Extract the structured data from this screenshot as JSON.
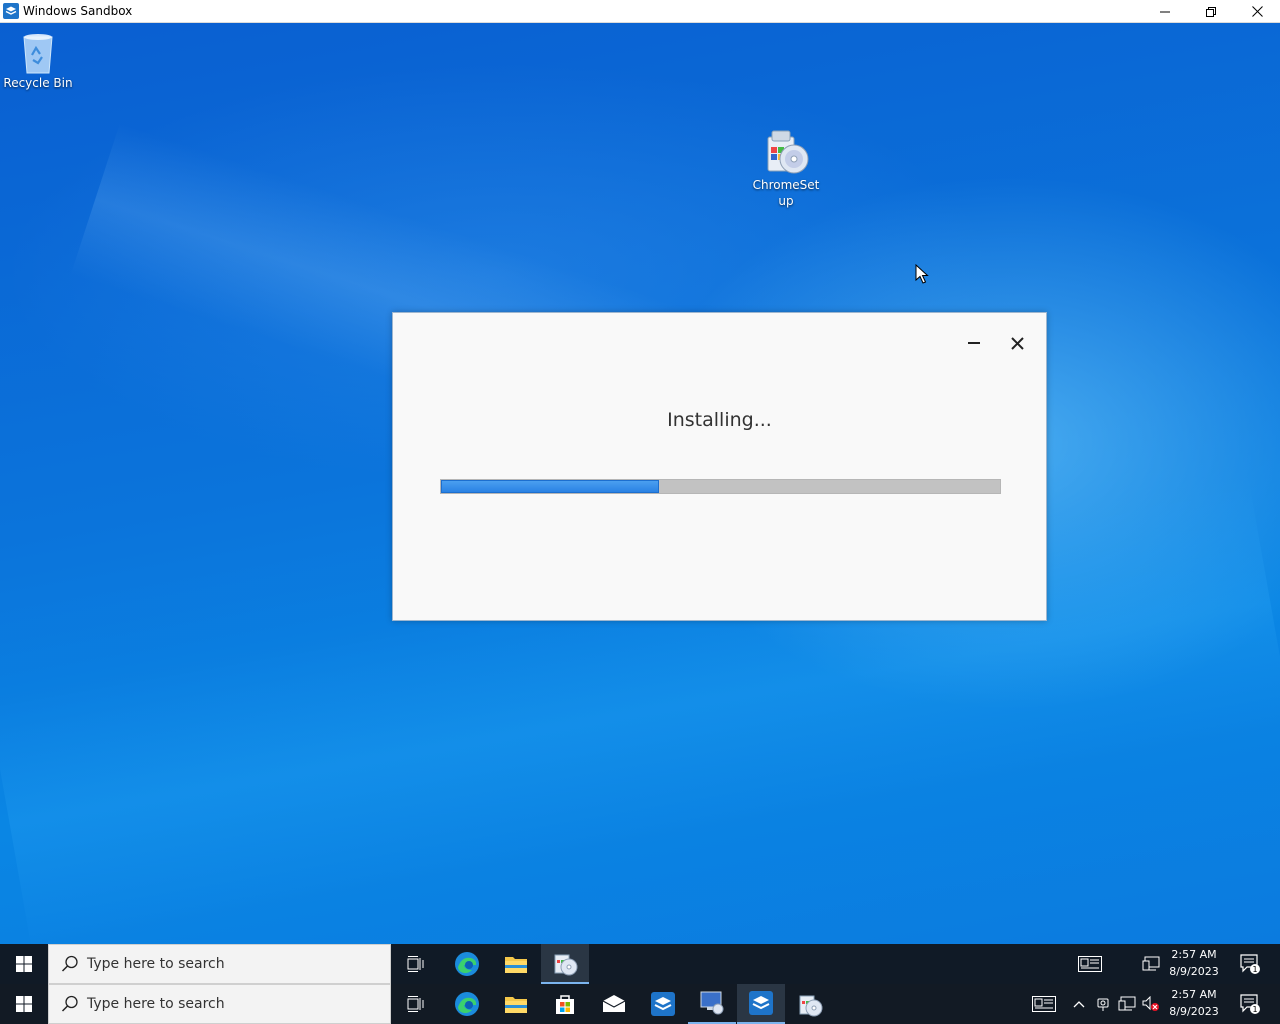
{
  "window": {
    "title": "Windows Sandbox",
    "icon": "windows-sandbox-icon",
    "controls": [
      "minimize-icon",
      "restore-icon",
      "close-icon"
    ]
  },
  "desktop": {
    "icons": [
      {
        "label": "Recycle Bin",
        "icon": "recycle-bin-icon"
      },
      {
        "label": "ChromeSetup",
        "icon": "installer-cd-icon"
      }
    ]
  },
  "installer": {
    "status": "Installing...",
    "progress": 0.39,
    "controls": [
      "minimize-icon",
      "close-icon"
    ],
    "colors": {
      "fill": "#2a82e4",
      "track": "#c2c2c2"
    }
  },
  "taskbar_top": {
    "search_placeholder": "Type here to search",
    "apps": [
      "task-view-icon",
      "edge-icon",
      "file-explorer-icon",
      "installer-cd-icon"
    ],
    "tray": [
      "news-icon",
      "network-icon"
    ],
    "time": "2:57 AM",
    "date": "8/9/2023",
    "notification_count": "1"
  },
  "taskbar_bottom": {
    "search_placeholder": "Type here to search",
    "apps": [
      "task-view-icon",
      "edge-icon",
      "file-explorer-icon",
      "store-icon",
      "mail-icon",
      "sandbox-icon",
      "remote-desktop-icon",
      "sandbox-icon",
      "installer-cd-icon"
    ],
    "tray": [
      "news-icon",
      "chevron-up-icon",
      "meet-icon",
      "network-icon",
      "volume-muted-icon"
    ],
    "time": "2:57 AM",
    "date": "8/9/2023",
    "notification_count": "1"
  }
}
